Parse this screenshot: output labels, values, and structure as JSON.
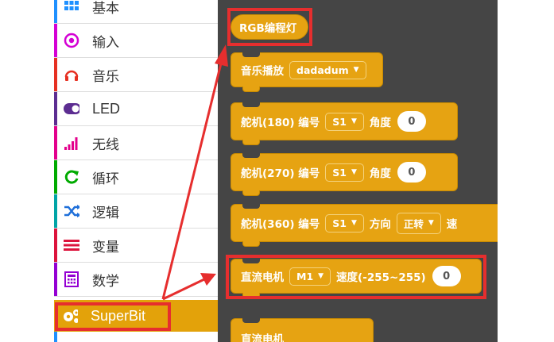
{
  "sidebar": {
    "categories": [
      {
        "label": "基本",
        "icon": "grid-icon",
        "color": "#1e90ff"
      },
      {
        "label": "输入",
        "icon": "target-icon",
        "color": "#d400d4"
      },
      {
        "label": "音乐",
        "icon": "headphones-icon",
        "color": "#e63022"
      },
      {
        "label": "LED",
        "icon": "toggle-icon",
        "color": "#5c2d91"
      },
      {
        "label": "无线",
        "icon": "signal-bars-icon",
        "color": "#e3008c"
      },
      {
        "label": "循环",
        "icon": "refresh-icon",
        "color": "#00aa00"
      },
      {
        "label": "逻辑",
        "icon": "shuffle-icon",
        "color": "#00a4a6"
      },
      {
        "label": "变量",
        "icon": "list-icon",
        "color": "#dc143c"
      },
      {
        "label": "数学",
        "icon": "calculator-icon",
        "color": "#9400d3"
      },
      {
        "label": "SuperBit",
        "icon": "gears-icon",
        "color": "#e3a20a"
      }
    ]
  },
  "blocks": {
    "rgb": {
      "label": "RGB编程灯"
    },
    "music": {
      "label": "音乐播放",
      "dropdown": "dadadum"
    },
    "servo180": {
      "label": "舵机(180) 编号",
      "dropdown": "S1",
      "angle_label": "角度",
      "value": "0"
    },
    "servo270": {
      "label": "舵机(270) 编号",
      "dropdown": "S1",
      "angle_label": "角度",
      "value": "0"
    },
    "servo360": {
      "label": "舵机(360) 编号",
      "dropdown": "S1",
      "dir_label": "方向",
      "dir_value": "正转",
      "speed_label": "速"
    },
    "dcmotor": {
      "label": "直流电机",
      "dropdown": "M1",
      "speed_label": "速度(-255~255)",
      "value": "0"
    },
    "dcmotor2": {
      "label": "直流电机"
    }
  },
  "colors": {
    "annotation": "#e62e2e",
    "block": "#e6a312",
    "workspace": "#454545"
  }
}
